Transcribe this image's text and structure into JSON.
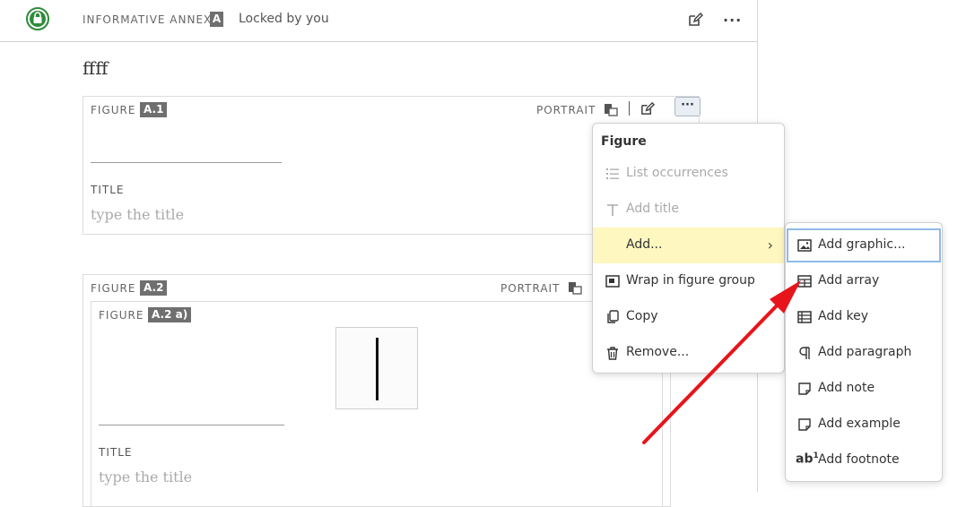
{
  "header": {
    "annex_label": "INFORMATIVE ANNEX",
    "annex_badge": "A",
    "lock_status": "Locked by you"
  },
  "document": {
    "heading": "ffff",
    "figures": [
      {
        "label": "FIGURE",
        "number": "A.1",
        "orientation": "PORTRAIT",
        "title_label": "TITLE",
        "title_placeholder": "type the title"
      },
      {
        "label": "FIGURE",
        "number": "A.2",
        "orientation": "PORTRAIT",
        "subfigure": {
          "label": "FIGURE",
          "number": "A.2 a)",
          "title_label": "TITLE",
          "title_placeholder": "type the title"
        }
      }
    ]
  },
  "context_menu": {
    "title": "Figure",
    "items": [
      {
        "label": "List occurrences",
        "icon": "list-icon",
        "disabled": true
      },
      {
        "label": "Add title",
        "icon": "text-icon",
        "disabled": true
      },
      {
        "label": "Add...",
        "icon": "none",
        "has_submenu": true,
        "active": true
      },
      {
        "label": "Wrap in figure group",
        "icon": "figure-group-icon"
      },
      {
        "label": "Copy",
        "icon": "copy-icon"
      },
      {
        "label": "Remove...",
        "icon": "trash-icon"
      }
    ]
  },
  "submenu": {
    "items": [
      {
        "label": "Add graphic...",
        "icon": "image-icon",
        "focused": true
      },
      {
        "label": "Add array",
        "icon": "table-icon"
      },
      {
        "label": "Add key",
        "icon": "key-table-icon"
      },
      {
        "label": "Add paragraph",
        "icon": "pilcrow-icon"
      },
      {
        "label": "Add note",
        "icon": "note-icon"
      },
      {
        "label": "Add example",
        "icon": "example-icon"
      },
      {
        "label": "Add footnote",
        "icon": "footnote-icon",
        "icon_text": "ab"
      }
    ]
  },
  "colors": {
    "lock_green": "#2e8b3a",
    "active_item": "#fff7c0",
    "arrow_red": "#e8141b",
    "focus_outline": "#8fb9e8"
  }
}
